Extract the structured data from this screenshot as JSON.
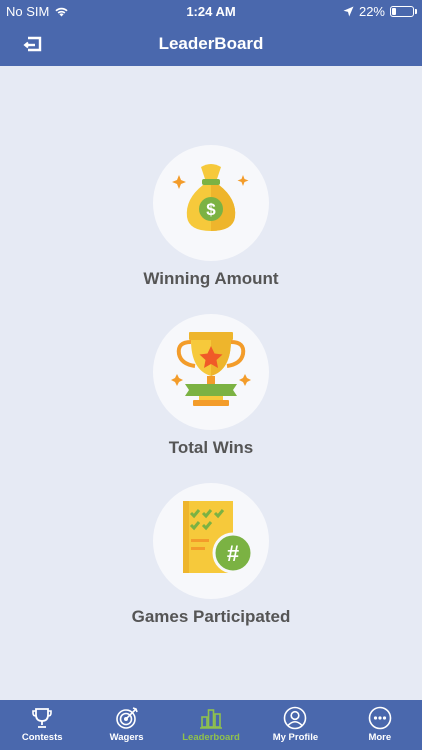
{
  "status_bar": {
    "carrier": "No SIM",
    "time": "1:24 AM",
    "battery": "22%",
    "battery_level": 0.22
  },
  "header": {
    "title": "LeaderBoard"
  },
  "cards": [
    {
      "label": "Winning Amount",
      "icon": "money-bag-icon"
    },
    {
      "label": "Total Wins",
      "icon": "trophy-icon"
    },
    {
      "label": "Games Participated",
      "icon": "checklist-number-icon"
    }
  ],
  "tabbar": {
    "items": [
      {
        "label": "Contests",
        "icon": "trophy-icon"
      },
      {
        "label": "Wagers",
        "icon": "target-icon"
      },
      {
        "label": "Leaderboard",
        "icon": "bar-chart-icon",
        "active": true
      },
      {
        "label": "My Profile",
        "icon": "user-icon"
      },
      {
        "label": "More",
        "icon": "more-icon"
      }
    ]
  },
  "colors": {
    "primary": "#4a68ad",
    "background": "#e6eaf4",
    "active_tab": "#8fc14d"
  }
}
